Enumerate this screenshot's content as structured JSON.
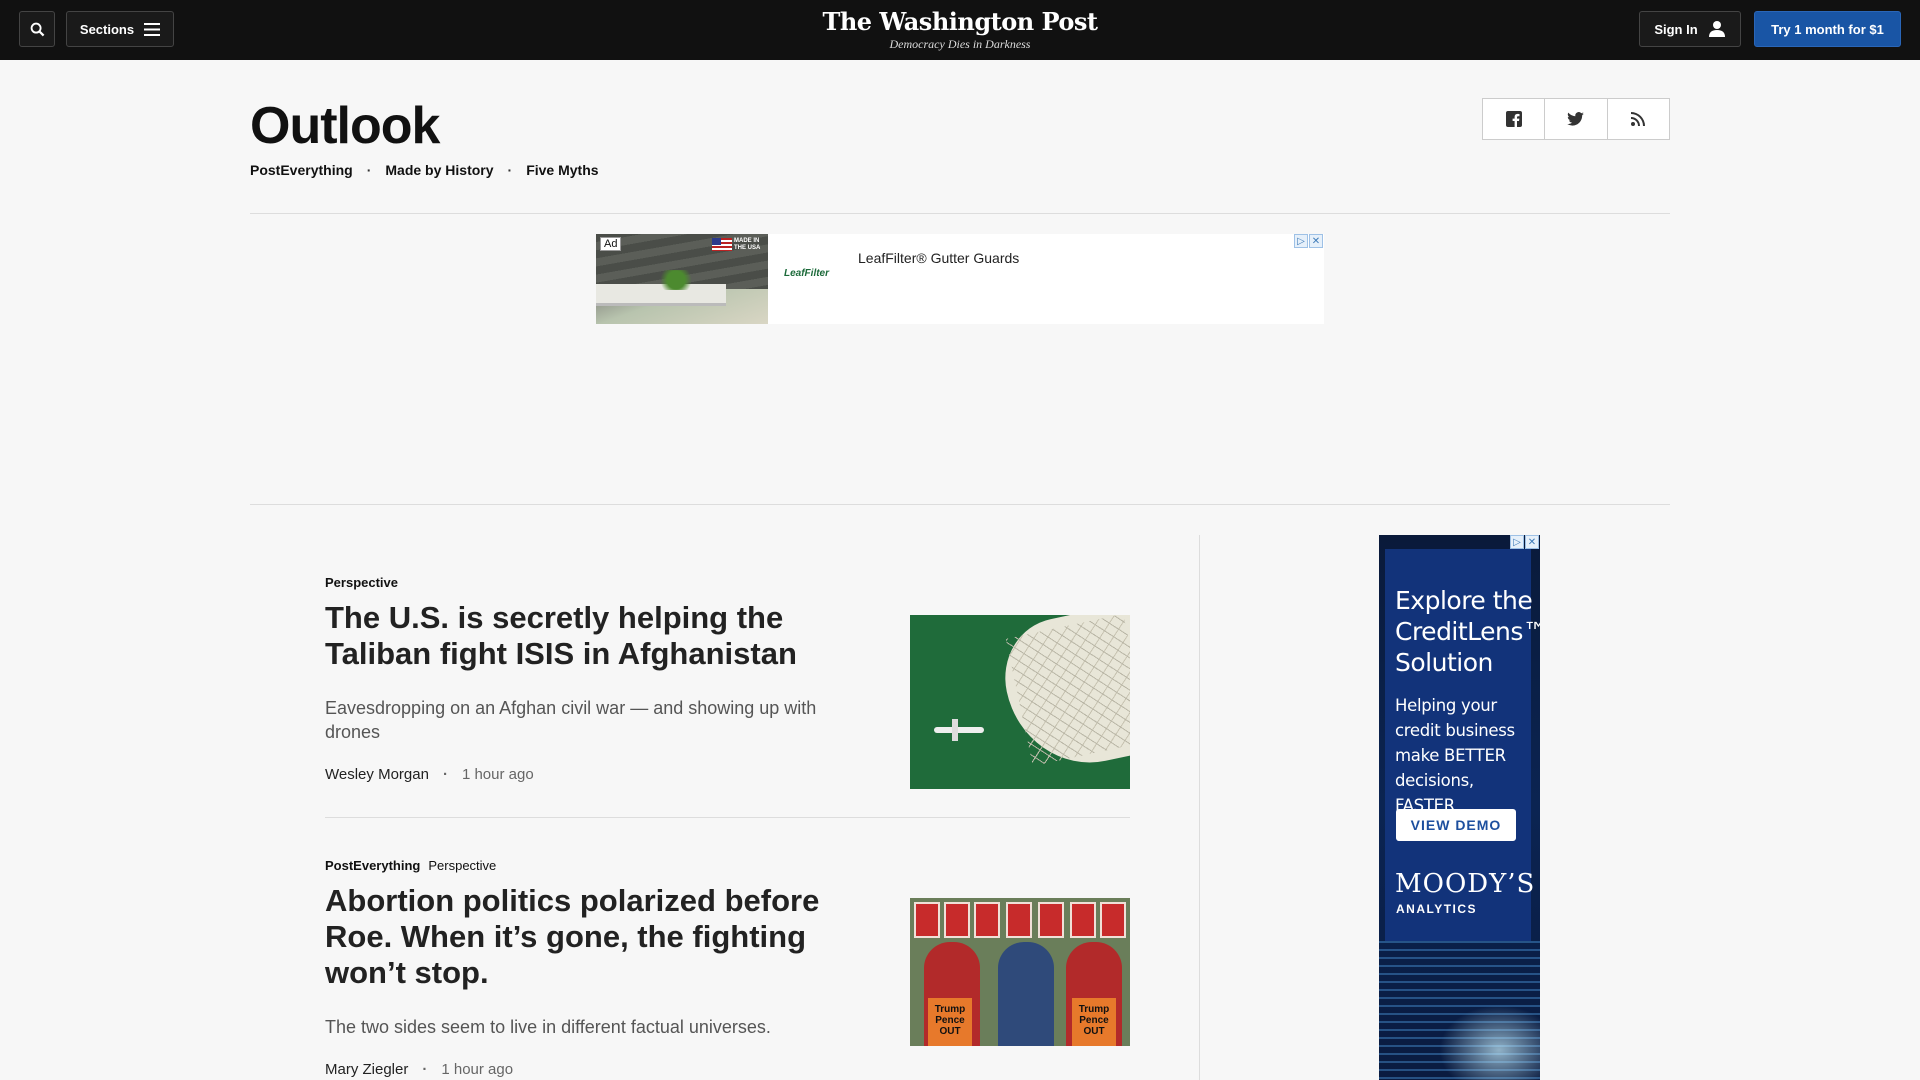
{
  "topbar": {
    "sections_label": "Sections",
    "masthead_name": "The Washington Post",
    "masthead_tagline": "Democracy Dies in Darkness",
    "signin_label": "Sign In",
    "subscribe_label": "Try 1 month for $1"
  },
  "header": {
    "title": "Outlook",
    "subnav": [
      "PostEverything",
      "Made by History",
      "Five Myths"
    ]
  },
  "ad_banner": {
    "label": "Ad",
    "badge": "MADE IN THE USA",
    "logo": "LeafFilter",
    "headline": "LeafFilter® Gutter Guards"
  },
  "articles": [
    {
      "kicker": "Perspective",
      "kicker_extra": "",
      "headline": "The U.S. is secretly helping the Taliban fight ISIS in Afghanistan",
      "dek": "Eavesdropping on an Afghan civil war — and showing up with drones",
      "author": "Wesley Morgan",
      "time": "1 hour ago"
    },
    {
      "kicker": "PostEverything",
      "kicker_extra": "Perspective",
      "headline": "Abortion politics polarized before Roe. When it’s gone, the fighting won’t stop.",
      "dek": "The two sides seem to live in different factual universes.",
      "author": "Mary Ziegler",
      "time": "1 hour ago",
      "image_text": [
        "Trump Pence OUT",
        "Trump Pence OUT"
      ]
    }
  ],
  "side_ad": {
    "title": "Explore the CreditLens™ Solution",
    "body": "Helping your credit business make BETTER decisions, FASTER",
    "cta": "VIEW DEMO",
    "brand": "MOODY’S",
    "brand_sub": "ANALYTICS"
  }
}
